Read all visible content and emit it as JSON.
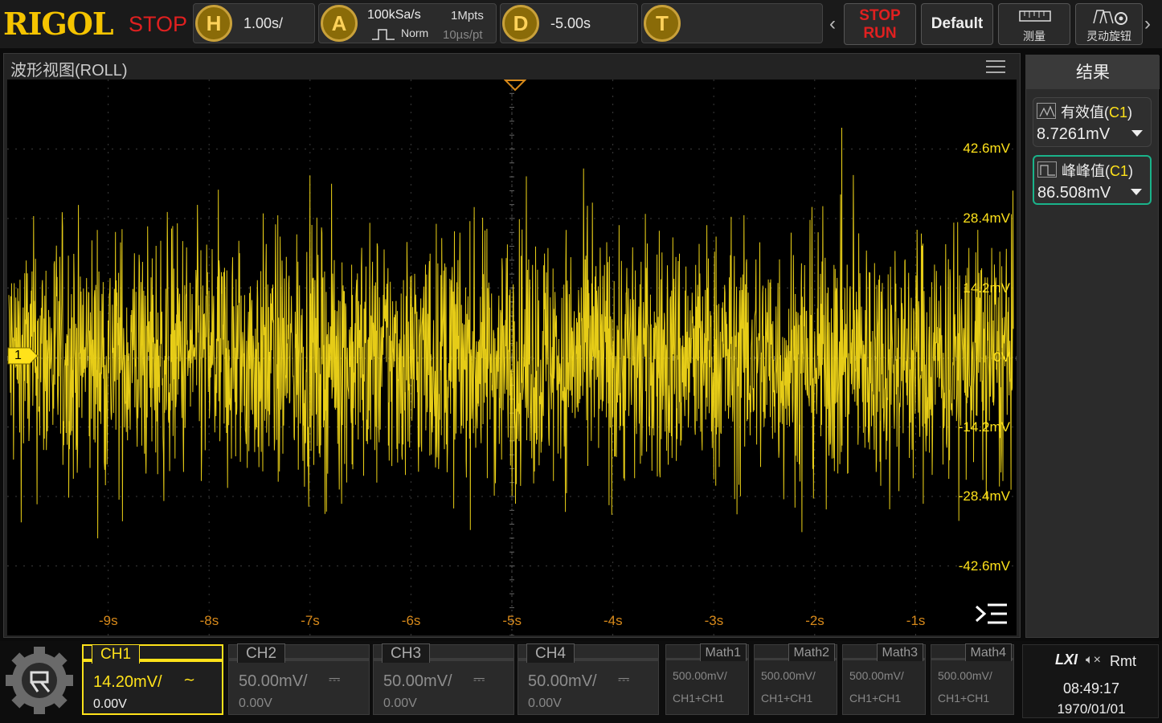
{
  "topbar": {
    "logo": "RIGOL",
    "run_state": "STOP",
    "horizontal": {
      "badge": "H",
      "timebase": "1.00s/"
    },
    "acquire": {
      "badge": "A",
      "sample_rate": "100kSa/s",
      "memory_depth": "1Mpts",
      "mode": "Norm",
      "time_per_point": "10µs/pt"
    },
    "delay": {
      "badge": "D",
      "offset": "-5.00s"
    },
    "trigger": {
      "badge": "T"
    },
    "stoprun_stop": "STOP",
    "stoprun_run": "RUN",
    "default_label": "Default",
    "measure_label": "测量",
    "knob_label": "灵动旋钮"
  },
  "wave": {
    "title": "波形视图(ROLL)",
    "channel_marker": "1",
    "v_labels": [
      "42.6mV",
      "28.4mV",
      "14.2mV",
      "0V",
      "-14.2mV",
      "-28.4mV",
      "-42.6mV"
    ],
    "h_labels": [
      "-9s",
      "-8s",
      "-7s",
      "-6s",
      "-5s",
      "-4s",
      "-3s",
      "-2s",
      "-1s"
    ],
    "trace_color": "#ffe21a"
  },
  "results": {
    "header": "结果",
    "items": [
      {
        "name": "有效值",
        "source": "C1",
        "value": "8.7261mV"
      },
      {
        "name": "峰峰值",
        "source": "C1",
        "value": "86.508mV"
      }
    ]
  },
  "channels": [
    {
      "name": "CH1",
      "scale": "14.20mV/",
      "coupling": "∼",
      "offset": "0.00V",
      "active": true
    },
    {
      "name": "CH2",
      "scale": "50.00mV/",
      "coupling": "⎓",
      "offset": "0.00V",
      "active": false
    },
    {
      "name": "CH3",
      "scale": "50.00mV/",
      "coupling": "⎓",
      "offset": "0.00V",
      "active": false
    },
    {
      "name": "CH4",
      "scale": "50.00mV/",
      "coupling": "⎓",
      "offset": "0.00V",
      "active": false
    }
  ],
  "math": [
    {
      "name": "Math1",
      "scale": "500.00mV/",
      "source": "CH1+CH1"
    },
    {
      "name": "Math2",
      "scale": "500.00mV/",
      "source": "CH1+CH1"
    },
    {
      "name": "Math3",
      "scale": "500.00mV/",
      "source": "CH1+CH1"
    },
    {
      "name": "Math4",
      "scale": "500.00mV/",
      "source": "CH1+CH1"
    }
  ],
  "status": {
    "lxi": "LXI",
    "remote": "Rmt",
    "time": "08:49:17",
    "date": "1970/01/01"
  }
}
